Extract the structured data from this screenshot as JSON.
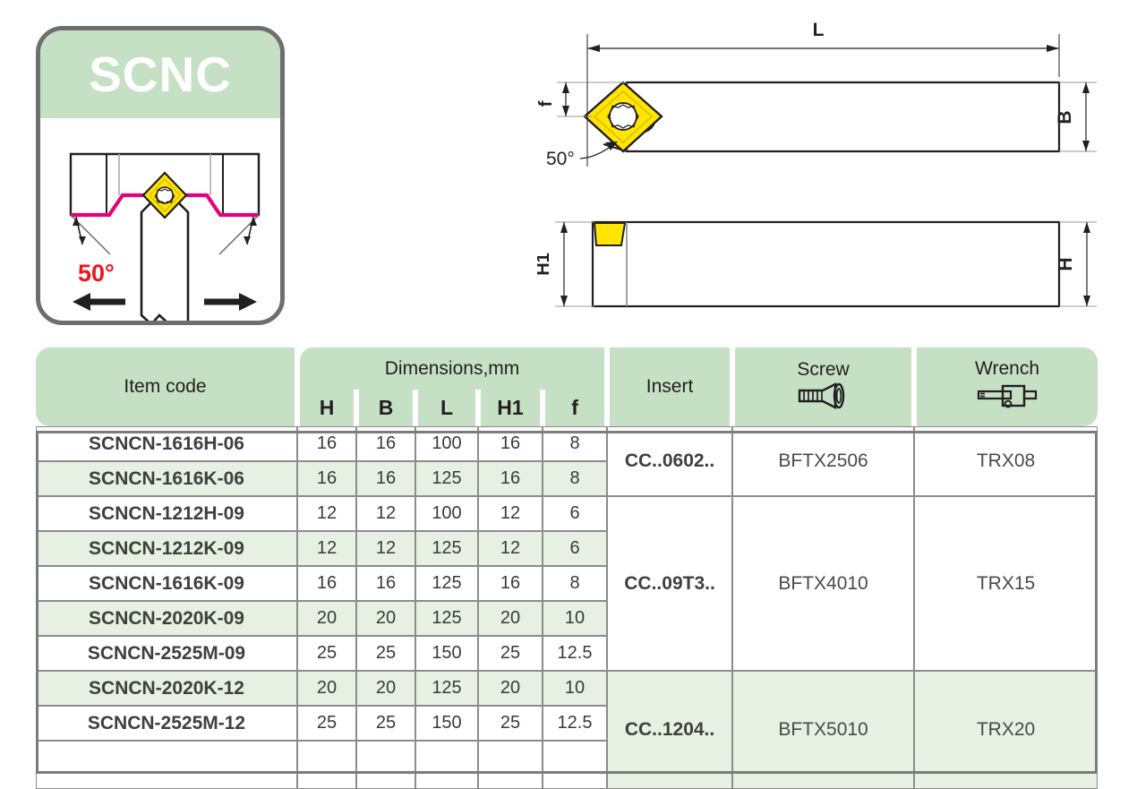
{
  "logo": {
    "title": "SCNC",
    "angle_label": "50°",
    "band_color": "#c5e0c4",
    "profile_color": "#e6007e",
    "insert_color": "#ffe500",
    "angle_color": "#e8161f",
    "border_color": "#6e6e6e"
  },
  "drawings": {
    "top_view": {
      "length_label": "L",
      "width_label": "B",
      "offset_label": "f",
      "angle_label": "50°"
    },
    "side_view": {
      "height1_label": "H1",
      "height_label": "H"
    },
    "insert_color": "#ffe500",
    "line_color": "#231f20"
  },
  "table": {
    "headers": {
      "item_code": "Item code",
      "dimensions_group": "Dimensions,mm",
      "dimension_cols": [
        "H",
        "B",
        "L",
        "H1",
        "f"
      ],
      "insert": "Insert",
      "screw": "Screw",
      "screw_icon": "screw-icon",
      "wrench": "Wrench",
      "wrench_icon": "wrench-icon"
    },
    "header_bg": "#c5e0c4",
    "row_tint_bg": "#e7f0e2",
    "rows": [
      {
        "code": "SCNCN-1616H-06",
        "H": "16",
        "B": "16",
        "L": "100",
        "H1": "16",
        "f": "8",
        "tint": false
      },
      {
        "code": "SCNCN-1616K-06",
        "H": "16",
        "B": "16",
        "L": "125",
        "H1": "16",
        "f": "8",
        "tint": true
      },
      {
        "code": "SCNCN-1212H-09",
        "H": "12",
        "B": "12",
        "L": "100",
        "H1": "12",
        "f": "6",
        "tint": false
      },
      {
        "code": "SCNCN-1212K-09",
        "H": "12",
        "B": "12",
        "L": "125",
        "H1": "12",
        "f": "6",
        "tint": true
      },
      {
        "code": "SCNCN-1616K-09",
        "H": "16",
        "B": "16",
        "L": "125",
        "H1": "16",
        "f": "8",
        "tint": false
      },
      {
        "code": "SCNCN-2020K-09",
        "H": "20",
        "B": "20",
        "L": "125",
        "H1": "20",
        "f": "10",
        "tint": true
      },
      {
        "code": "SCNCN-2525M-09",
        "H": "25",
        "B": "25",
        "L": "150",
        "H1": "25",
        "f": "12.5",
        "tint": false
      },
      {
        "code": "SCNCN-2020K-12",
        "H": "20",
        "B": "20",
        "L": "125",
        "H1": "20",
        "f": "10",
        "tint": true
      },
      {
        "code": "SCNCN-2525M-12",
        "H": "25",
        "B": "25",
        "L": "150",
        "H1": "25",
        "f": "12.5",
        "tint": false
      },
      {
        "code": "",
        "H": "",
        "B": "",
        "L": "",
        "H1": "",
        "f": "",
        "tint": false
      }
    ],
    "groups": [
      {
        "insert": "CC..0602..",
        "screw": "BFTX2506",
        "wrench": "TRX08",
        "span": 2
      },
      {
        "insert": "CC..09T3..",
        "screw": "BFTX4010",
        "wrench": "TRX15",
        "span": 5
      },
      {
        "insert": "CC..1204..",
        "screw": "BFTX5010",
        "wrench": "TRX20",
        "span": 3
      }
    ]
  }
}
